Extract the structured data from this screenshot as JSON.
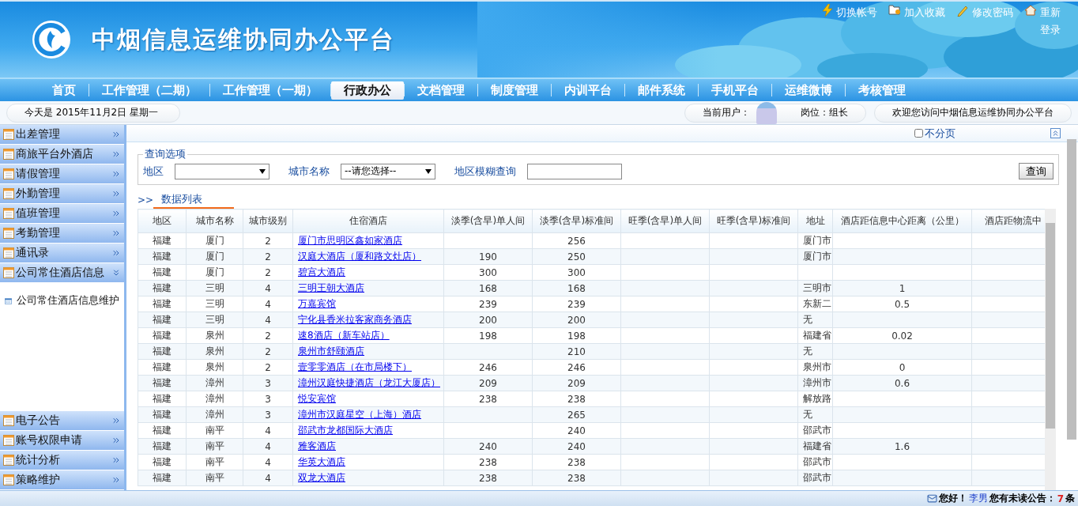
{
  "header": {
    "title": "中烟信息运维协同办公平台",
    "links": [
      {
        "kind": "switch",
        "label": "切换帐号"
      },
      {
        "kind": "favorite",
        "label": "加入收藏"
      },
      {
        "kind": "password",
        "label": "修改密码"
      },
      {
        "kind": "home",
        "label": "重新登录"
      }
    ]
  },
  "nav": [
    {
      "label": "首页",
      "selected": false
    },
    {
      "label": "工作管理（二期）",
      "selected": false
    },
    {
      "label": "工作管理（一期）",
      "selected": false
    },
    {
      "label": "行政办公",
      "selected": true
    },
    {
      "label": "文档管理",
      "selected": false
    },
    {
      "label": "制度管理",
      "selected": false
    },
    {
      "label": "内训平台",
      "selected": false
    },
    {
      "label": "邮件系统",
      "selected": false
    },
    {
      "label": "手机平台",
      "selected": false
    },
    {
      "label": "运维微博",
      "selected": false
    },
    {
      "label": "考核管理",
      "selected": false
    }
  ],
  "info_bar": {
    "date": "今天是  2015年11月2日  星期一",
    "user_label": "当前用户：",
    "position": "岗位：组长",
    "welcome": "欢迎您访问中烟信息运维协同办公平台"
  },
  "sidebar": {
    "top": [
      {
        "label": "出差管理",
        "expanded": false
      },
      {
        "label": "商旅平台外酒店",
        "expanded": false
      },
      {
        "label": "请假管理",
        "expanded": false
      },
      {
        "label": "外勤管理",
        "expanded": false
      },
      {
        "label": "值班管理",
        "expanded": false
      },
      {
        "label": "考勤管理",
        "expanded": false
      },
      {
        "label": "通讯录",
        "expanded": false
      },
      {
        "label": "公司常住酒店信息",
        "expanded": true,
        "children": [
          "公司常住酒店信息维护"
        ]
      }
    ],
    "bottom": [
      {
        "label": "电子公告",
        "expanded": false
      },
      {
        "label": "账号权限申请",
        "expanded": false
      },
      {
        "label": "统计分析",
        "expanded": false
      },
      {
        "label": "策略维护",
        "expanded": false
      }
    ]
  },
  "no_paging": {
    "label": "不分页",
    "checked": false
  },
  "query": {
    "legend": "查询选项",
    "region_label": "地区",
    "city_label": "城市名称",
    "city_value": "--请您选择--",
    "fuzzy_label": "地区模糊查询",
    "button": "查询"
  },
  "list_tab": {
    "arrow": ">>",
    "label": "数据列表"
  },
  "table": {
    "columns": [
      "地区",
      "城市名称",
      "城市级别",
      "住宿酒店",
      "淡季(含早)单人间",
      "淡季(含早)标准间",
      "旺季(含早)单人间",
      "旺季(含早)标准间",
      "地址",
      "酒店距信息中心距离（公里）",
      "酒店距物流中"
    ],
    "rows": [
      [
        "福建",
        "厦门",
        "2",
        "厦门市思明区鑫如家酒店",
        "",
        "256",
        "",
        "",
        "厦门市",
        "",
        ""
      ],
      [
        "福建",
        "厦门",
        "2",
        "汉庭大酒店（厦和路文灶店）",
        "190",
        "250",
        "",
        "",
        "厦门市",
        "",
        ""
      ],
      [
        "福建",
        "厦门",
        "2",
        "碧宫大酒店",
        "300",
        "300",
        "",
        "",
        "",
        "",
        ""
      ],
      [
        "福建",
        "三明",
        "4",
        "三明王朝大酒店",
        "168",
        "168",
        "",
        "",
        "三明市",
        "1",
        ""
      ],
      [
        "福建",
        "三明",
        "4",
        "万嘉宾馆",
        "239",
        "239",
        "",
        "",
        "东新二",
        "0.5",
        ""
      ],
      [
        "福建",
        "三明",
        "4",
        "宁化县香米拉客家商务酒店",
        "200",
        "200",
        "",
        "",
        "无",
        "",
        ""
      ],
      [
        "福建",
        "泉州",
        "2",
        "速8酒店（新车站店）",
        "198",
        "198",
        "",
        "",
        "福建省",
        "0.02",
        ""
      ],
      [
        "福建",
        "泉州",
        "2",
        "泉州市舒颐酒店",
        "",
        "210",
        "",
        "",
        "无",
        "",
        ""
      ],
      [
        "福建",
        "泉州",
        "2",
        "壹零零酒店（在市局楼下）",
        "246",
        "246",
        "",
        "",
        "泉州市",
        "0",
        ""
      ],
      [
        "福建",
        "漳州",
        "3",
        "漳州汉庭快捷酒店（龙江大厦店）",
        "209",
        "209",
        "",
        "",
        "漳州市",
        "0.6",
        ""
      ],
      [
        "福建",
        "漳州",
        "3",
        "悦安宾馆",
        "238",
        "238",
        "",
        "",
        "解放路",
        "",
        ""
      ],
      [
        "福建",
        "漳州",
        "3",
        "漳州市汉庭星空（上海）酒店",
        "",
        "265",
        "",
        "",
        "无",
        "",
        ""
      ],
      [
        "福建",
        "南平",
        "4",
        "邵武市龙都国际大酒店",
        "",
        "240",
        "",
        "",
        "邵武市",
        "",
        ""
      ],
      [
        "福建",
        "南平",
        "4",
        "雅客酒店",
        "240",
        "240",
        "",
        "",
        "福建省",
        "1.6",
        ""
      ],
      [
        "福建",
        "南平",
        "4",
        "华英大酒店",
        "238",
        "238",
        "",
        "",
        "邵武市",
        "",
        ""
      ],
      [
        "福建",
        "南平",
        "4",
        "双龙大酒店",
        "238",
        "238",
        "",
        "",
        "邵武市",
        "",
        ""
      ]
    ]
  },
  "footer": {
    "greeting": "您好！",
    "user": "李男",
    "message": "您有未读公告：",
    "count": "7",
    "unit": "条"
  }
}
